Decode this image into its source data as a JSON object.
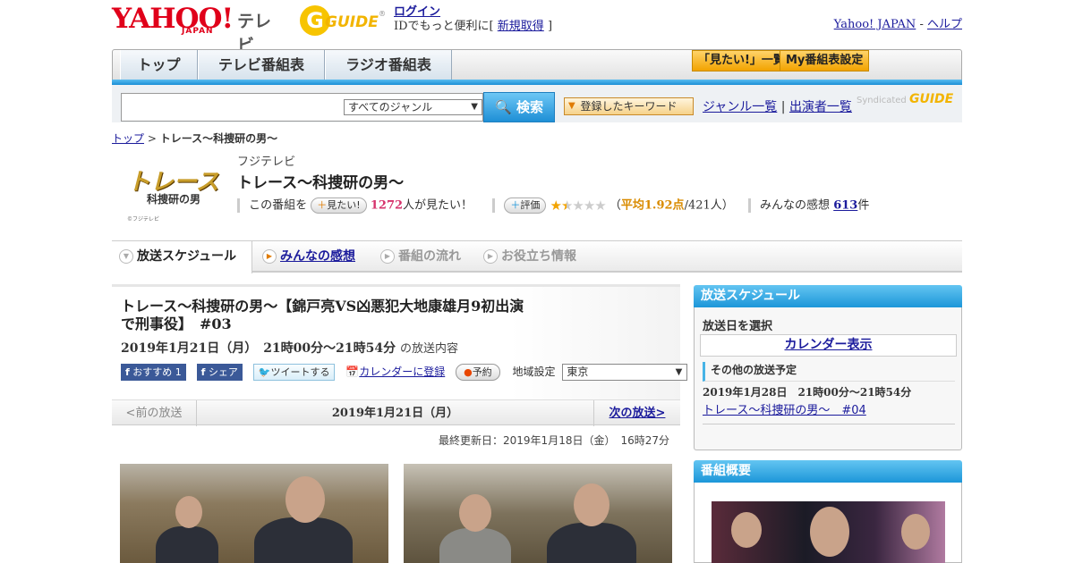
{
  "header": {
    "yahoo_logo": "YAHOO!",
    "yahoo_sub": "JAPAN",
    "tv_label": "テレビ",
    "gguide_logo": "GUIDE",
    "login_link": "ログイン",
    "login_msg_pre": "IDでもっと便利に[",
    "signup_link": "新規取得",
    "login_msg_post": "]",
    "yahoo_japan_link": "Yahoo! JAPAN",
    "separator": "-",
    "help_link": "ヘルプ"
  },
  "nav": {
    "tabs": [
      "トップ",
      "テレビ番組表",
      "ラジオ番組表"
    ],
    "want_list_button": "「見たい!」一覧",
    "my_schedule_button": "My番組表設定"
  },
  "search": {
    "placeholder": "",
    "genre_selected": "すべてのジャンル",
    "search_button": "検索",
    "keyword_button": "登録したキーワード",
    "genre_list_link": "ジャンル一覧",
    "divider": "|",
    "performer_list_link": "出演者一覧",
    "syndicated": "Syndicated"
  },
  "breadcrumb": {
    "top": "トップ",
    "sep": ">",
    "current": "トレース～科捜研の男～"
  },
  "program": {
    "logo_main": "トレース",
    "logo_sub": "科捜研の男",
    "logo_copy": "©フジテレビ",
    "channel": "フジテレビ",
    "title": "トレース～科捜研の男～",
    "want_pre": "この番組を",
    "want_button": "見たい!",
    "want_count": "1272",
    "want_post": "人が見たい！",
    "rating_button": "評価",
    "rating_average": 1.92,
    "rating_pre": "（",
    "rating_label": "平均1.92点",
    "rating_post": "/421人）",
    "review_pre": "みんなの感想",
    "review_count": "613",
    "review_post": "件"
  },
  "subtabs": [
    "放送スケジュール",
    "みんなの感想",
    "番組の流れ",
    "お役立ち情報"
  ],
  "episode": {
    "title": "トレース～科捜研の男～【錦戸亮VS凶悪犯大地康雄月9初出演で刑事役】　#03",
    "date_time": "2019年1月21日（月）　21時00分～21時54分",
    "date_suffix": "の放送内容",
    "fb_recommend": "おすすめ 1",
    "fb_share": "シェア",
    "tweet": "ツイートする",
    "calendar_link": "カレンダーに登録",
    "reserve_button": "予約",
    "region_label": "地域設定",
    "region_selected": "東京"
  },
  "pager": {
    "prev": "<前の放送",
    "current": "2019年1月21日（月）",
    "next": "次の放送>"
  },
  "updated": "最終更新日：2019年1月18日（金）　16時27分",
  "sidebar": {
    "schedule_header": "放送スケジュール",
    "select_date_label": "放送日を選択",
    "calendar_button": "カレンダー表示",
    "other_schedule_label": "その他の放送予定",
    "other_date": "2019年1月28日　21時00分～21時54分",
    "other_link": "トレース～科捜研の男～　#04",
    "overview_header": "番組概要"
  },
  "colors": {
    "accent_blue": "#1c96d9",
    "yahoo_red": "#e0001a",
    "gguide_yellow": "#f7c400",
    "link": "#1b1b9c"
  }
}
